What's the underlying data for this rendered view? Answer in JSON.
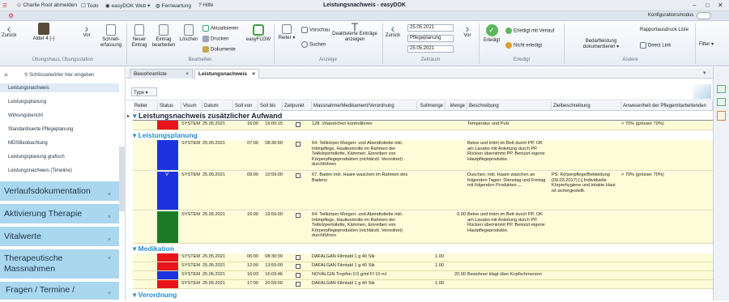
{
  "titlebar": {
    "user_logout": "Charlie Root abmelden",
    "todo": "Todo",
    "easydok_web": "easyDOK Web",
    "remote": "Fernwartung",
    "help": "Hilfe",
    "title": "Leistungsnachweis - easyDOK",
    "config_mode": "Konfigurationsmodus"
  },
  "ribbon": {
    "back": "Zurück",
    "resident": "Alder 4 (-)",
    "forward": "Vor",
    "quick_entry": "Schnell-erfassung",
    "group_overview": "Übungshaus, Übungsstation",
    "new_entry": "Neuer Eintrag",
    "edit_entry": "Eintrag bearbeiten",
    "delete": "Löschen",
    "refresh": "Aktualisieren",
    "print": "Drucken",
    "documents": "Dokumente",
    "easyflow": "easyFLOW",
    "group_edit": "Bearbeiten",
    "tabs_btn": "Reiter",
    "preview": "Vorschau",
    "search": "Suchen",
    "deactivated": "Deaktivierte Einträge anzeigen",
    "group_view": "Anzeige",
    "back2": "Zurück",
    "date_from": "25.05.2021",
    "date_type": "Pflegeplanung",
    "date_to": "25.05.2021",
    "forward2": "Vor",
    "group_period": "Zeitraum",
    "done": "Erledigt",
    "done_with_progress": "Erledigt mit Verlauf",
    "not_done": "Nicht erledigt",
    "group_done": "Erledigt",
    "need_doc": "Bedarfleistung dokumentieren",
    "report_print": "Rapportausdruck Liste",
    "direct_link": "Direct Link",
    "group_other": "Andere",
    "filter": "Filter"
  },
  "left": {
    "search_placeholder": "Schlüsselwörter hier eingeben",
    "nav": [
      "Leistungsnachweis",
      "Leistungsplanung",
      "Wirkungsbericht",
      "Standardisierte Pflegeplanung",
      "MDSBeobachtung",
      "Leistungsplanung grafisch",
      "Leistungsnachweis (Timeline)"
    ],
    "accordion": [
      "Verlaufsdokumentation",
      "Aktivierung Therapie",
      "Vitalwerte",
      "Therapeutische Massnahmen",
      "Fragen / Termine /"
    ]
  },
  "tabs": [
    "Bewohnerliste",
    "Leistungsnachweis"
  ],
  "table": {
    "type_label": "Type",
    "headers": [
      "Reiter",
      "Status",
      "Visum",
      "Datum",
      "Soll von",
      "Soll bis",
      "Zeitpunkt",
      "Massnahme/Medikament/Verordnung",
      "Sollmenge",
      "Menge",
      "Beschreibung",
      "Zielbeschreibung",
      "Anwesenheit der Pflegemitarbeitenden"
    ],
    "sections": {
      "s1": "Leistungsnachweis zusätzlicher Aufwand",
      "s2": "Leistungsplanung",
      "s3": "Medikation",
      "s4": "Verordnung"
    },
    "rows": [
      {
        "status_color": "#e8141c",
        "visum": "SYSTEM",
        "datum": "25.05.2021",
        "von": "16:00",
        "bis": "16:00:15",
        "massnahme": "128. Vitalzeichen kontrollieren",
        "soll": "",
        "menge": "",
        "beschr": "Temperatur und Puls",
        "ziel": "",
        "anw": "> 70% (grösser 70%)",
        "status_mark": ""
      },
      {
        "status_color": "#1d33e0",
        "visum": "SYSTEM",
        "datum": "25.05.2021",
        "von": "07:00",
        "bis": "08:30:00",
        "massnahme": "64. Teilkörper Morgen- und Abendtoilette inkl. Intimpflege, Hautkontrolle im Rahmen der Teilkörpertoilette, Kämmen, Einreiben von Körperpflegeprodukten (nichtärztl. Verordnet) durchführen",
        "soll": "",
        "menge": "",
        "beschr": "Beine und Intim im Bett durch PP. OK am Lavabo mit Anleitung durch PP. Rücken übernimmt PP. Benutzt eigene Hautpflegeprodukte.",
        "ziel": "",
        "anw": "",
        "status_mark": ""
      },
      {
        "status_color": "#1d33e0",
        "visum": "SYSTEM",
        "datum": "25.05.2021",
        "von": "09:00",
        "bis": "10:59:00",
        "massnahme": "67. Baden inkl. Haare waschen im Rahmen des Badens",
        "soll": "",
        "menge": "",
        "beschr": "Duschen, inkl. Haare waschen an folgenden Tagen: Dienstag und Freitag mit folgenden Produkten....",
        "ziel": "PS: Körperpflege/Bekleidung (09.03.2017)   [-] Individuelle Körperhygiene und intakte Haut ist sichergestellt.",
        "anw": "> 70% (grösser 70%)",
        "status_mark": "V"
      },
      {
        "status_color": "#1a7a26",
        "visum": "SYSTEM",
        "datum": "25.05.2021",
        "von": "16:00",
        "bis": "19:59:00",
        "massnahme": "64. Teilkörper Morgen- und Abendtoilette inkl. Intimpflege, Hautkontrolle im Rahmen der Teilkörpertoilette, Kämmen, Einreiben von Körperpflegeprodukten (nichtärztl. Verordnet) durchführen",
        "soll": "",
        "menge": "0.00",
        "beschr": "Beine und Intim im Bett durch PP. OK am Lavabo mit Anleitung durch PP. Rücken übernimmt PP. Benutzt eigene Hautpflegeprodukte.",
        "ziel": "",
        "anw": "",
        "status_mark": ""
      },
      {
        "status_color": "#e8141c",
        "visum": "SYSTEM",
        "datum": "25.05.2021",
        "von": "06:00",
        "bis": "08:30:00",
        "massnahme": "DAFALGAN Filmtabl 1 g 40 Stk",
        "soll": "1.00",
        "menge": "",
        "beschr": "",
        "ziel": "",
        "anw": "",
        "status_mark": ""
      },
      {
        "status_color": "#e8141c",
        "visum": "SYSTEM",
        "datum": "25.05.2021",
        "von": "12:00",
        "bis": "13:59:00",
        "massnahme": "DAFALGAN Filmtabl 1 g 40 Stk",
        "soll": "1.00",
        "menge": "",
        "beschr": "",
        "ziel": "",
        "anw": "",
        "status_mark": ""
      },
      {
        "status_color": "#1d33e0",
        "visum": "SYSTEM",
        "datum": "25.05.2021",
        "von": "16:03",
        "bis": "16:03:46",
        "massnahme": "NOVALGIN Tropfen 0.5 g/ml Fl 10 ml",
        "soll": "",
        "menge": "20.00",
        "beschr": "Bewohner klagt über Kopfschmerzen",
        "ziel": "",
        "anw": "",
        "status_mark": ""
      },
      {
        "status_color": "#e8141c",
        "visum": "SYSTEM",
        "datum": "25.05.2021",
        "von": "17:00",
        "bis": "20:59:00",
        "massnahme": "DAFALGAN Filmtabl 1 g 40 Stk",
        "soll": "1.00",
        "menge": "",
        "beschr": "",
        "ziel": "",
        "anw": "",
        "status_mark": ""
      }
    ]
  }
}
